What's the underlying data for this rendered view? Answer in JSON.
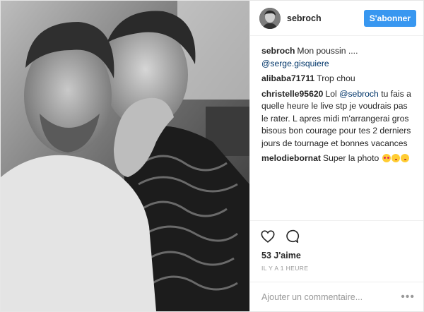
{
  "post": {
    "author": "sebroch",
    "follow_label": "S'abonner",
    "likes": "53 J'aime",
    "time_ago": "IL Y A 1 HEURE",
    "comment_placeholder": "Ajouter un commentaire...",
    "more_label": "•••"
  },
  "comments": [
    {
      "author": "sebroch",
      "text": "Mon poussin .... ",
      "mention": "@serge.gisquiere",
      "tail": ""
    },
    {
      "author": "alibaba71711",
      "text": "Trop chou",
      "mention": "",
      "tail": ""
    },
    {
      "author": "christelle95620",
      "text": "Lol ",
      "mention": "@sebroch",
      "tail": " tu fais a quelle heure le live stp je voudrais pas le rater. L apres midi m'arrangerai gros bisous bon courage pour tes 2 derniers jours de tournage et bonnes vacances"
    },
    {
      "author": "melodiebornat",
      "text": "Super la photo ",
      "mention": "",
      "tail": ""
    }
  ],
  "icons": {
    "like": "heart-icon",
    "comment": "speech-bubble-icon",
    "more": "more-options-icon"
  },
  "colors": {
    "accent": "#3897f0",
    "mention": "#003569",
    "meta": "#999999"
  }
}
